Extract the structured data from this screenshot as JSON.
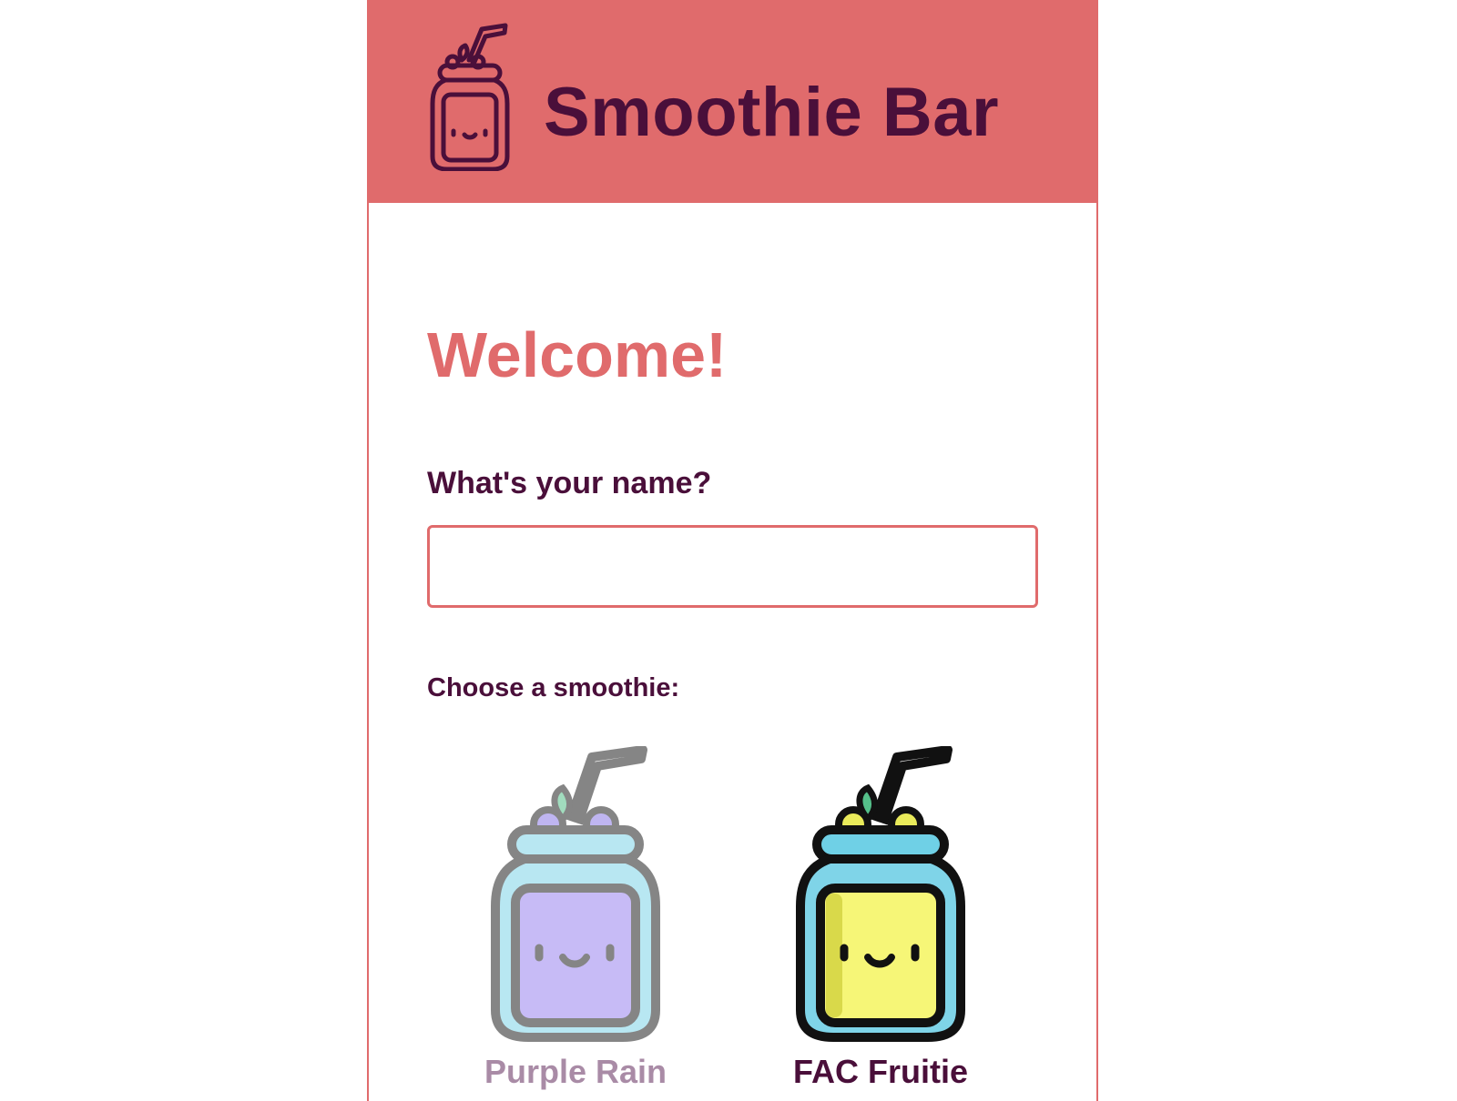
{
  "header": {
    "title": "Smoothie Bar",
    "logo_icon": "smoothie-jar-icon"
  },
  "main": {
    "heading": "Welcome!",
    "name_label": "What's your name?",
    "name_input": {
      "value": "",
      "placeholder": ""
    },
    "choose_label": "Choose a smoothie:"
  },
  "smoothies": [
    {
      "label": "Purple Rain",
      "icon": "purple-smoothie-jar-icon",
      "fill_color": "#c3b4f7",
      "label_color": "#a98ba6",
      "state": "faded"
    },
    {
      "label": "FAC Fruitie",
      "icon": "yellow-smoothie-jar-icon",
      "fill_color": "#f6f677",
      "label_color": "#4a0f3a",
      "state": "active"
    }
  ],
  "colors": {
    "brand": "#e06b6c",
    "text_dark": "#4a0f3a"
  }
}
